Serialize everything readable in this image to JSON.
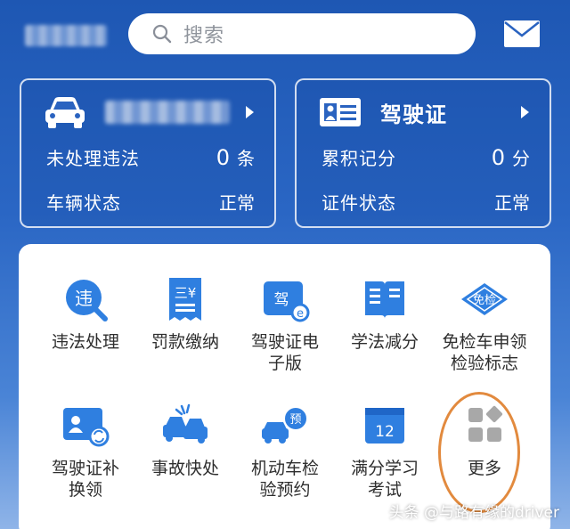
{
  "search": {
    "placeholder": "搜索"
  },
  "vehicle_card": {
    "rows": [
      {
        "label": "未处理违法",
        "count": "0",
        "unit": "条"
      },
      {
        "label": "车辆状态",
        "value": "正常"
      }
    ]
  },
  "license_card": {
    "title": "驾驶证",
    "rows": [
      {
        "label": "累积记分",
        "count": "0",
        "unit": "分"
      },
      {
        "label": "证件状态",
        "value": "正常"
      }
    ]
  },
  "services": [
    {
      "label": "违法处理",
      "icon": "violation-icon"
    },
    {
      "label": "罚款缴纳",
      "icon": "fine-receipt-icon"
    },
    {
      "label": "驾驶证电子版",
      "icon": "e-license-icon"
    },
    {
      "label": "学法减分",
      "icon": "book-icon"
    },
    {
      "label": "免检车申领检验标志",
      "icon": "exempt-inspection-icon"
    },
    {
      "label": "驾驶证补换领",
      "icon": "license-replace-icon"
    },
    {
      "label": "事故快处",
      "icon": "accident-icon"
    },
    {
      "label": "机动车检验预约",
      "icon": "inspection-booking-icon"
    },
    {
      "label": "满分学习考试",
      "icon": "calendar-exam-icon"
    },
    {
      "label": "更多",
      "icon": "more-grid-icon"
    }
  ],
  "icon_text": {
    "violation": "违",
    "fine": "三¥",
    "e_license": "驾",
    "exempt": "免检",
    "booking": "预",
    "calendar": "12"
  },
  "labels_wrapped": {
    "s2": [
      "驾驶证电",
      "子版"
    ],
    "s4": [
      "免检车申领",
      "检验标志"
    ],
    "s5": [
      "驾驶证补",
      "换领"
    ],
    "s7": [
      "机动车检",
      "验预约"
    ],
    "s8": [
      "满分学习",
      "考试"
    ]
  },
  "watermark": "头条 @与路有缘的driver",
  "colors": {
    "accent": "#2f7fe0",
    "highlight_ring": "#e28a3e",
    "bg_top": "#1e57b3"
  }
}
